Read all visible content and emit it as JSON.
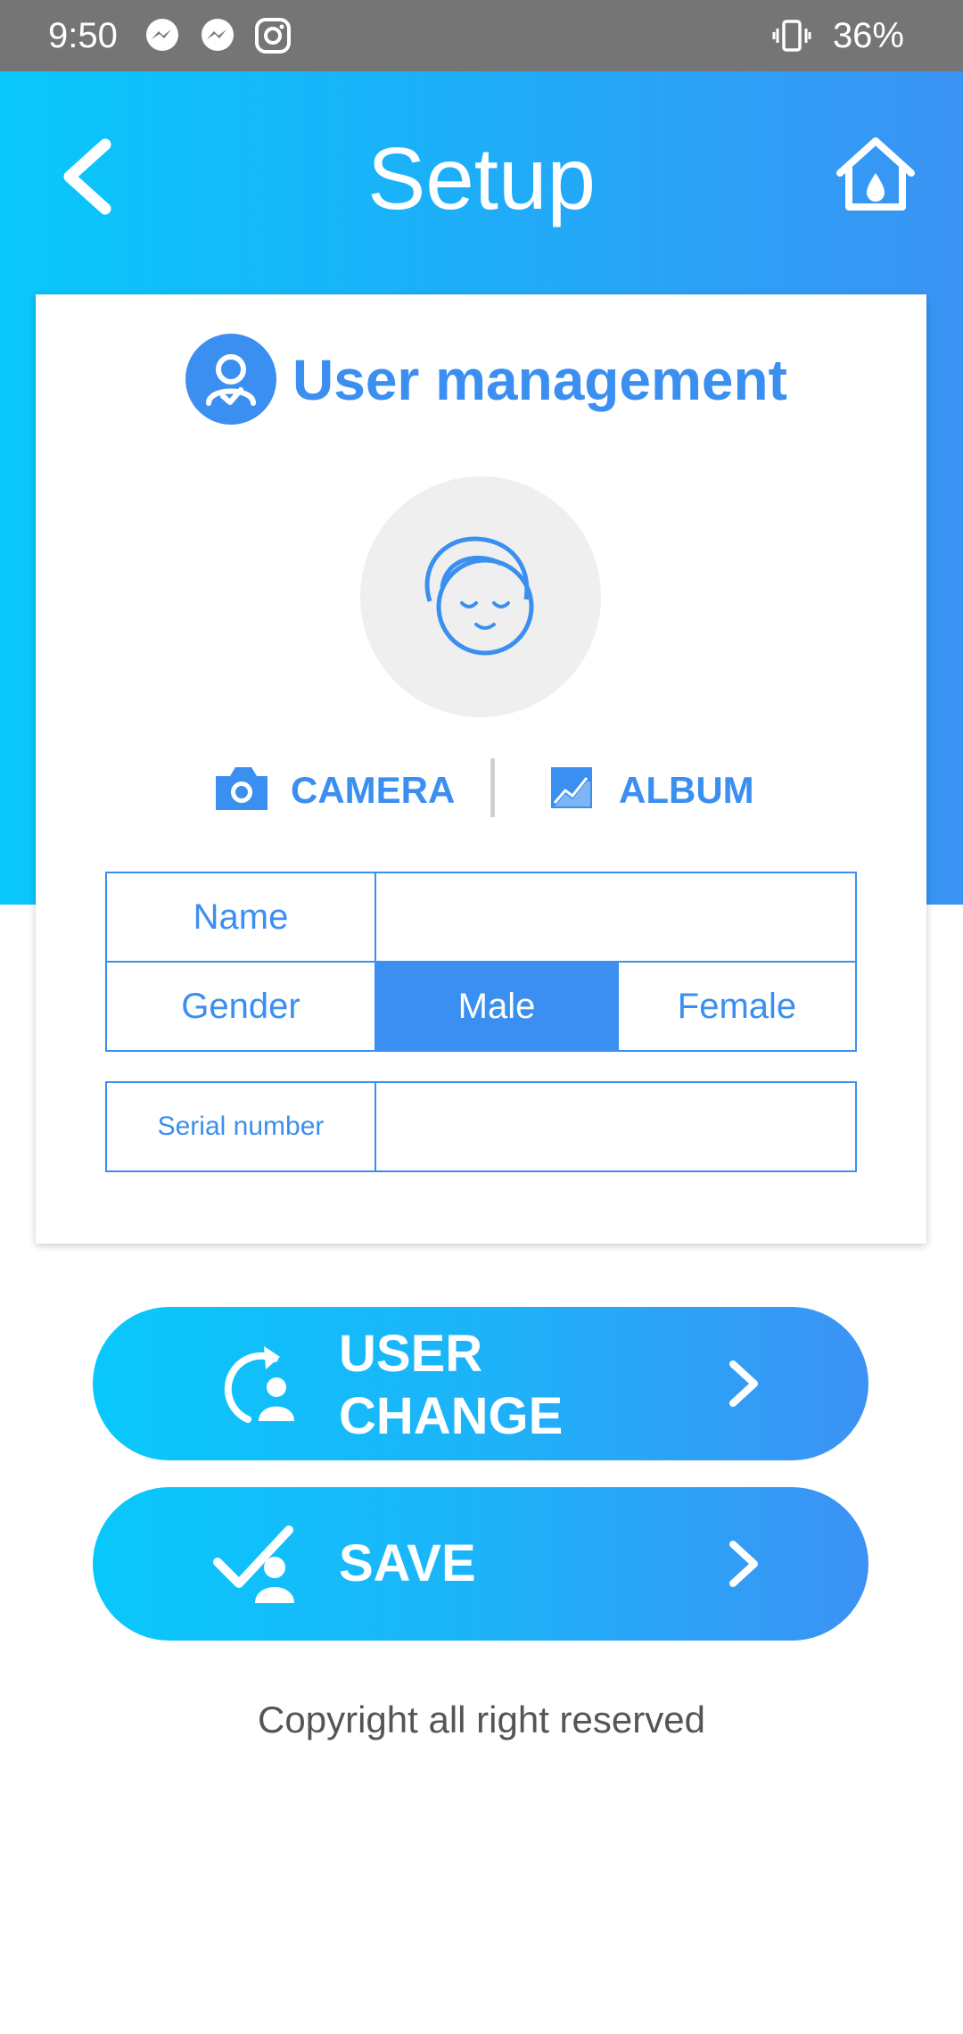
{
  "status_bar": {
    "time": "9:50",
    "notification_icons": [
      "messenger-icon",
      "messenger-icon",
      "instagram-icon"
    ],
    "vibrate_icon": "vibrate-icon",
    "battery": "36%"
  },
  "header": {
    "title": "Setup",
    "back_icon": "chevron-left-icon",
    "home_icon": "home-icon"
  },
  "card": {
    "title": "User management",
    "title_icon": "user-check-icon",
    "avatar_icon": "face-avatar-icon",
    "camera_label": "CAMERA",
    "album_label": "ALBUM",
    "name_label": "Name",
    "name_value": "",
    "gender_label": "Gender",
    "gender_options": [
      "Male",
      "Female"
    ],
    "gender_selected": "Male",
    "serial_label": "Serial number",
    "serial_value": ""
  },
  "buttons": {
    "user_change_line1": "USER",
    "user_change_line2": "CHANGE",
    "save": "SAVE"
  },
  "footer": {
    "copyright": "Copyright all right reserved"
  },
  "colors": {
    "accent": "#3a8ff0",
    "gradient_start": "#08c8fb",
    "gradient_end": "#3c92f4",
    "status_bar": "#757575"
  }
}
